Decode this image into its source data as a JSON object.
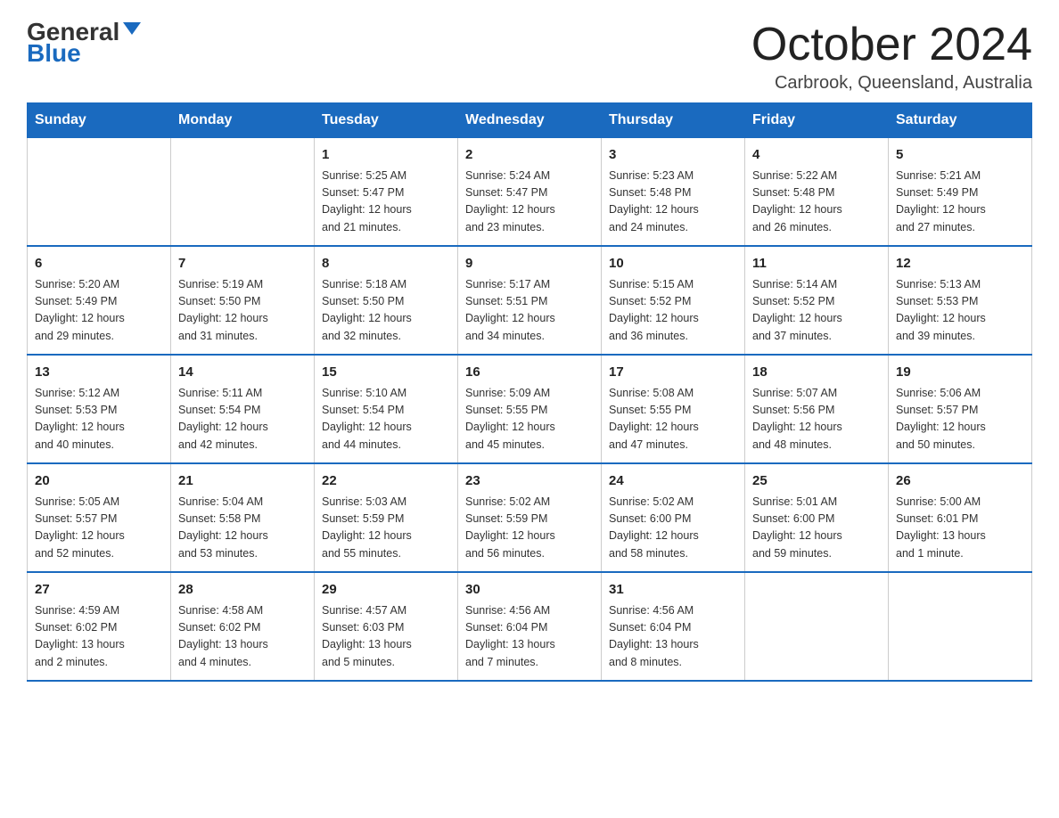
{
  "header": {
    "logo_general": "General",
    "logo_blue": "Blue",
    "title": "October 2024",
    "subtitle": "Carbrook, Queensland, Australia"
  },
  "days_of_week": [
    "Sunday",
    "Monday",
    "Tuesday",
    "Wednesday",
    "Thursday",
    "Friday",
    "Saturday"
  ],
  "weeks": [
    [
      {
        "day": "",
        "info": ""
      },
      {
        "day": "",
        "info": ""
      },
      {
        "day": "1",
        "info": "Sunrise: 5:25 AM\nSunset: 5:47 PM\nDaylight: 12 hours\nand 21 minutes."
      },
      {
        "day": "2",
        "info": "Sunrise: 5:24 AM\nSunset: 5:47 PM\nDaylight: 12 hours\nand 23 minutes."
      },
      {
        "day": "3",
        "info": "Sunrise: 5:23 AM\nSunset: 5:48 PM\nDaylight: 12 hours\nand 24 minutes."
      },
      {
        "day": "4",
        "info": "Sunrise: 5:22 AM\nSunset: 5:48 PM\nDaylight: 12 hours\nand 26 minutes."
      },
      {
        "day": "5",
        "info": "Sunrise: 5:21 AM\nSunset: 5:49 PM\nDaylight: 12 hours\nand 27 minutes."
      }
    ],
    [
      {
        "day": "6",
        "info": "Sunrise: 5:20 AM\nSunset: 5:49 PM\nDaylight: 12 hours\nand 29 minutes."
      },
      {
        "day": "7",
        "info": "Sunrise: 5:19 AM\nSunset: 5:50 PM\nDaylight: 12 hours\nand 31 minutes."
      },
      {
        "day": "8",
        "info": "Sunrise: 5:18 AM\nSunset: 5:50 PM\nDaylight: 12 hours\nand 32 minutes."
      },
      {
        "day": "9",
        "info": "Sunrise: 5:17 AM\nSunset: 5:51 PM\nDaylight: 12 hours\nand 34 minutes."
      },
      {
        "day": "10",
        "info": "Sunrise: 5:15 AM\nSunset: 5:52 PM\nDaylight: 12 hours\nand 36 minutes."
      },
      {
        "day": "11",
        "info": "Sunrise: 5:14 AM\nSunset: 5:52 PM\nDaylight: 12 hours\nand 37 minutes."
      },
      {
        "day": "12",
        "info": "Sunrise: 5:13 AM\nSunset: 5:53 PM\nDaylight: 12 hours\nand 39 minutes."
      }
    ],
    [
      {
        "day": "13",
        "info": "Sunrise: 5:12 AM\nSunset: 5:53 PM\nDaylight: 12 hours\nand 40 minutes."
      },
      {
        "day": "14",
        "info": "Sunrise: 5:11 AM\nSunset: 5:54 PM\nDaylight: 12 hours\nand 42 minutes."
      },
      {
        "day": "15",
        "info": "Sunrise: 5:10 AM\nSunset: 5:54 PM\nDaylight: 12 hours\nand 44 minutes."
      },
      {
        "day": "16",
        "info": "Sunrise: 5:09 AM\nSunset: 5:55 PM\nDaylight: 12 hours\nand 45 minutes."
      },
      {
        "day": "17",
        "info": "Sunrise: 5:08 AM\nSunset: 5:55 PM\nDaylight: 12 hours\nand 47 minutes."
      },
      {
        "day": "18",
        "info": "Sunrise: 5:07 AM\nSunset: 5:56 PM\nDaylight: 12 hours\nand 48 minutes."
      },
      {
        "day": "19",
        "info": "Sunrise: 5:06 AM\nSunset: 5:57 PM\nDaylight: 12 hours\nand 50 minutes."
      }
    ],
    [
      {
        "day": "20",
        "info": "Sunrise: 5:05 AM\nSunset: 5:57 PM\nDaylight: 12 hours\nand 52 minutes."
      },
      {
        "day": "21",
        "info": "Sunrise: 5:04 AM\nSunset: 5:58 PM\nDaylight: 12 hours\nand 53 minutes."
      },
      {
        "day": "22",
        "info": "Sunrise: 5:03 AM\nSunset: 5:59 PM\nDaylight: 12 hours\nand 55 minutes."
      },
      {
        "day": "23",
        "info": "Sunrise: 5:02 AM\nSunset: 5:59 PM\nDaylight: 12 hours\nand 56 minutes."
      },
      {
        "day": "24",
        "info": "Sunrise: 5:02 AM\nSunset: 6:00 PM\nDaylight: 12 hours\nand 58 minutes."
      },
      {
        "day": "25",
        "info": "Sunrise: 5:01 AM\nSunset: 6:00 PM\nDaylight: 12 hours\nand 59 minutes."
      },
      {
        "day": "26",
        "info": "Sunrise: 5:00 AM\nSunset: 6:01 PM\nDaylight: 13 hours\nand 1 minute."
      }
    ],
    [
      {
        "day": "27",
        "info": "Sunrise: 4:59 AM\nSunset: 6:02 PM\nDaylight: 13 hours\nand 2 minutes."
      },
      {
        "day": "28",
        "info": "Sunrise: 4:58 AM\nSunset: 6:02 PM\nDaylight: 13 hours\nand 4 minutes."
      },
      {
        "day": "29",
        "info": "Sunrise: 4:57 AM\nSunset: 6:03 PM\nDaylight: 13 hours\nand 5 minutes."
      },
      {
        "day": "30",
        "info": "Sunrise: 4:56 AM\nSunset: 6:04 PM\nDaylight: 13 hours\nand 7 minutes."
      },
      {
        "day": "31",
        "info": "Sunrise: 4:56 AM\nSunset: 6:04 PM\nDaylight: 13 hours\nand 8 minutes."
      },
      {
        "day": "",
        "info": ""
      },
      {
        "day": "",
        "info": ""
      }
    ]
  ]
}
